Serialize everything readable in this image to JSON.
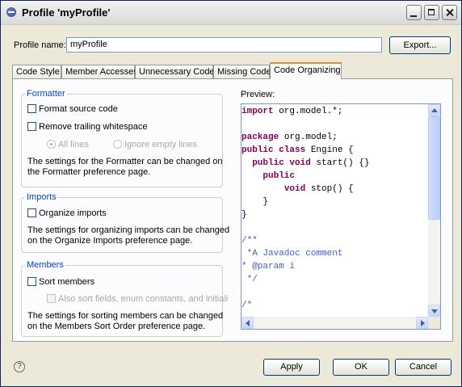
{
  "window": {
    "title": "Profile 'myProfile'"
  },
  "profile": {
    "label": "Profile name:",
    "value": "myProfile",
    "export_button": "Export..."
  },
  "tabs": [
    {
      "label": "Code Style"
    },
    {
      "label": "Member Accesses"
    },
    {
      "label": "Unnecessary Code"
    },
    {
      "label": "Missing Code"
    },
    {
      "label": "Code Organizing"
    }
  ],
  "formatter": {
    "title": "Formatter",
    "format_source": "Format source code",
    "remove_whitespace": "Remove trailing whitespace",
    "all_lines": "All lines",
    "ignore_empty": "Ignore empty lines",
    "info1": "The settings for the Formatter can be changed on",
    "info2": "the Formatter preference page."
  },
  "imports": {
    "title": "Imports",
    "organize": "Organize imports",
    "info1": "The settings for organizing imports can be changed",
    "info2": "on the Organize Imports preference page."
  },
  "members": {
    "title": "Members",
    "sort": "Sort members",
    "also_sort": "Also sort fields, enum constants, and initiali",
    "info1": "The settings for sorting members can be changed",
    "info2": "on the Members Sort Order preference page."
  },
  "preview": {
    "label": "Preview:",
    "lines": [
      "import org.model.*;",
      "",
      "package org.model;",
      "public class Engine {",
      "  public void start() {}",
      "    public",
      "        void stop() {",
      "    }",
      "}",
      "",
      "/**",
      " *A Javadoc comment",
      "* @param i",
      " */",
      "",
      "/*"
    ]
  },
  "buttons": {
    "apply": "Apply",
    "ok": "OK",
    "cancel": "Cancel"
  },
  "colors": {
    "keyword": "#7f0055",
    "javadoc": "#3f5fbf",
    "group_title": "#0046d5",
    "active_tab": "#e68b2c"
  }
}
